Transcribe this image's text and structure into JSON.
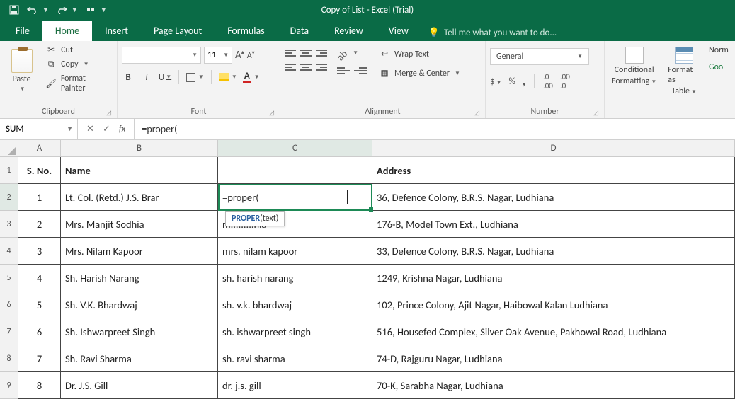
{
  "titlebar": {
    "title": "Copy of List - Excel (Trial)"
  },
  "tabs": {
    "file": "File",
    "home": "Home",
    "insert": "Insert",
    "pagelayout": "Page Layout",
    "formulas": "Formulas",
    "data": "Data",
    "review": "Review",
    "view": "View",
    "tellme_placeholder": "Tell me what you want to do..."
  },
  "ribbon": {
    "clipboard": {
      "label": "Clipboard",
      "paste": "Paste",
      "cut": "Cut",
      "copy": "Copy",
      "fmt": "Format Painter"
    },
    "font": {
      "label": "Font",
      "size": "11",
      "bold": "B",
      "italic": "I",
      "underline": "U"
    },
    "alignment": {
      "label": "Alignment",
      "wrap": "Wrap Text",
      "merge": "Merge & Center"
    },
    "number": {
      "label": "Number",
      "format": "General"
    },
    "styles": {
      "cond1": "Conditional",
      "cond2": "Formatting",
      "tbl1": "Format as",
      "tbl2": "Table",
      "norm": "Norm",
      "good": "Goo"
    }
  },
  "formulabar": {
    "namebox": "SUM",
    "formula": "=proper(",
    "fx": "fx"
  },
  "columns": {
    "A": "A",
    "B": "B",
    "C": "C",
    "D": "D"
  },
  "headers": {
    "sno": "S. No.",
    "name": "Name",
    "c": "",
    "address": "Address"
  },
  "activeCell": {
    "value": "=proper(",
    "tooltip_fn": "PROPER",
    "tooltip_arg": "(text)"
  },
  "rows": [
    {
      "n": "1",
      "name": "Lt. Col. (Retd.) J.S. Brar",
      "c": "",
      "addr": "36, Defence Colony, B.R.S. Nagar, Ludhiana"
    },
    {
      "n": "2",
      "name": "Mrs. Manjit Sodhia",
      "c": "m.........hia",
      "addr": "176-B, Model Town Ext., Ludhiana"
    },
    {
      "n": "3",
      "name": "Mrs. Nilam Kapoor",
      "c": "mrs. nilam kapoor",
      "addr": "33, Defence Colony, B.R.S. Nagar, Ludhiana"
    },
    {
      "n": "4",
      "name": "Sh. Harish Narang",
      "c": "sh. harish narang",
      "addr": "1249, Krishna Nagar, Ludhiana"
    },
    {
      "n": "5",
      "name": "Sh. V.K. Bhardwaj",
      "c": "sh. v.k. bhardwaj",
      "addr": "102, Prince Colony, Ajit Nagar, Haibowal Kalan Ludhiana"
    },
    {
      "n": "6",
      "name": "Sh. Ishwarpreet Singh",
      "c": "sh. ishwarpreet singh",
      "addr": "516, Housefed Complex, Silver Oak Avenue, Pakhowal Road, Ludhiana"
    },
    {
      "n": "7",
      "name": "Sh. Ravi Sharma",
      "c": "sh. ravi sharma",
      "addr": "74-D, Rajguru Nagar, Ludhiana"
    },
    {
      "n": "8",
      "name": "Dr. J.S. Gill",
      "c": "dr. j.s. gill",
      "addr": "70-K, Sarabha Nagar, Ludhiana"
    }
  ]
}
